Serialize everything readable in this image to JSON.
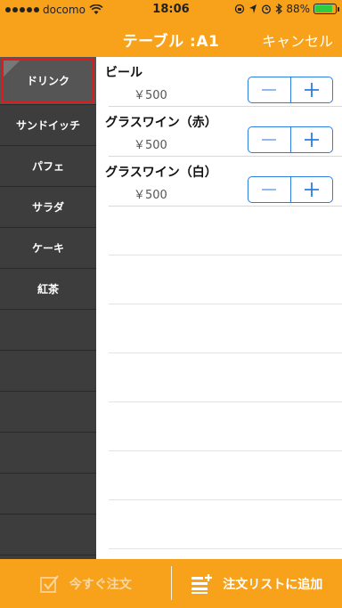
{
  "status_bar": {
    "carrier": "docomo",
    "time": "18:06",
    "battery": "88%",
    "battery_level": 0.88,
    "icons": [
      "signal-dots-icon",
      "wifi-icon",
      "lock-rotation-icon",
      "alarm-icon",
      "bluetooth-icon",
      "battery-icon"
    ]
  },
  "nav": {
    "title": "テーブル :A1",
    "cancel_label": "キャンセル"
  },
  "sidebar": {
    "items": [
      {
        "label": "ドリンク",
        "selected": true
      },
      {
        "label": "サンドイッチ"
      },
      {
        "label": "パフェ"
      },
      {
        "label": "サラダ"
      },
      {
        "label": "ケーキ"
      },
      {
        "label": "紅茶"
      }
    ]
  },
  "menu": {
    "items": [
      {
        "name": "ビール",
        "price": "￥500"
      },
      {
        "name": "グラスワイン（赤）",
        "price": "￥500"
      },
      {
        "name": "グラスワイン（白）",
        "price": "￥500"
      }
    ],
    "stepper": {
      "minus": "minus-icon",
      "plus": "plus-icon"
    }
  },
  "toolbar": {
    "order_now_label": "今すぐ注文",
    "add_to_list_label": "注文リストに追加"
  },
  "colors": {
    "accent": "#f8a21b",
    "sidebar": "#3d3d3d",
    "stepper": "#2a7de1",
    "selection_border": "#e11b1b"
  }
}
